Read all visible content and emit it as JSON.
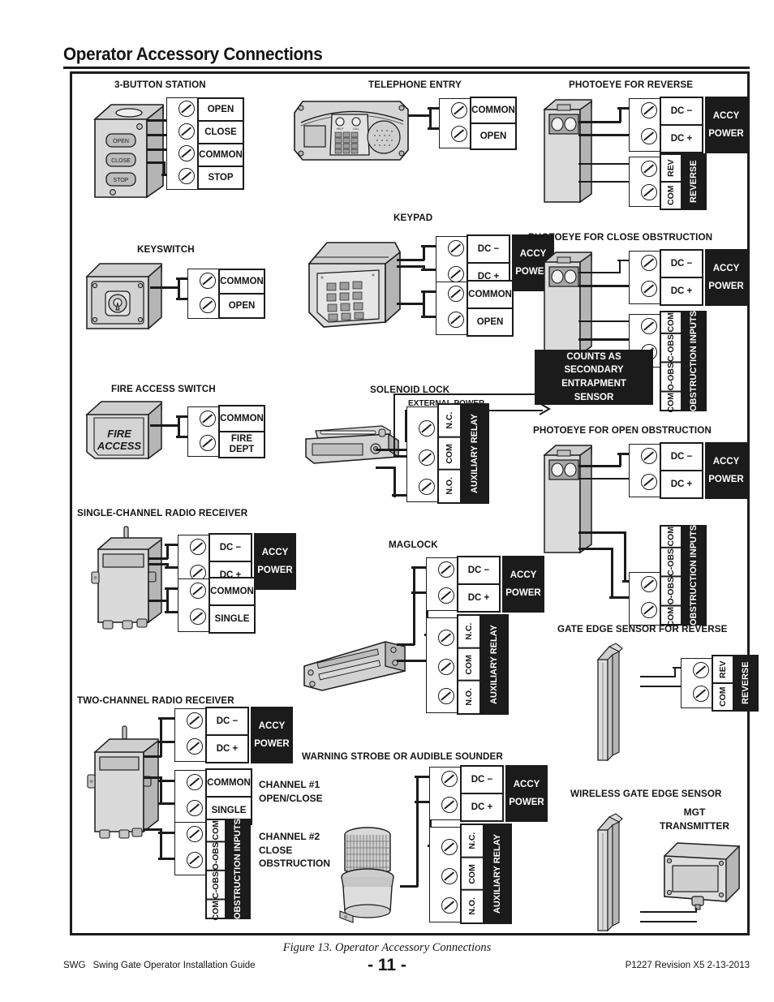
{
  "document": {
    "title": "Operator Accessory Connections",
    "figure_caption": "Figure 13. Operator Accessory Connections",
    "footer_left_code": "SWG",
    "footer_left_text": "Swing Gate Operator Installation Guide",
    "footer_page": "- 11 -",
    "footer_right": "P1227 Revision X5 2-13-2013"
  },
  "labels": {
    "open": "OPEN",
    "close": "CLOSE",
    "common": "COMMON",
    "stop": "STOP",
    "fire_dept": "FIRE DEPT",
    "single": "SINGLE",
    "dc_minus": "DC −",
    "dc_plus": "DC +",
    "accy": "ACCY",
    "power": "POWER",
    "com": "COM",
    "rev": "REV",
    "reverse": "REVERSE",
    "o_obs": "O-OBS",
    "c_obs": "C-OBS",
    "obstruction_inputs": "OBSTRUCTION INPUTS",
    "no": "N.O.",
    "nc": "N.C.",
    "auxiliary_relay": "AUXILIARY RELAY",
    "external_power": "EXTERNAL POWER",
    "fire_access_device": "FIRE ACCESS",
    "btn_open": "OPEN",
    "btn_close": "CLOSE",
    "btn_stop": "STOP"
  },
  "sections": {
    "three_button_station": {
      "title": "3-BUTTON STATION",
      "terminals": [
        "OPEN",
        "CLOSE",
        "COMMON",
        "STOP"
      ]
    },
    "keyswitch": {
      "title": "KEYSWITCH",
      "terminals": [
        "COMMON",
        "OPEN"
      ]
    },
    "fire_access_switch": {
      "title": "FIRE ACCESS SWITCH",
      "terminals": [
        "COMMON",
        "FIRE DEPT"
      ]
    },
    "single_channel_radio": {
      "title": "SINGLE-CHANNEL RADIO RECEIVER",
      "power_terminals": [
        "DC −",
        "DC +"
      ],
      "power_block": [
        "ACCY",
        "POWER"
      ],
      "signal_terminals": [
        "COMMON",
        "SINGLE"
      ]
    },
    "two_channel_radio": {
      "title": "TWO-CHANNEL RADIO RECEIVER",
      "power_terminals": [
        "DC −",
        "DC +"
      ],
      "power_block": [
        "ACCY",
        "POWER"
      ],
      "channel1_terminals": [
        "COMMON",
        "SINGLE"
      ],
      "channel1_note": [
        "CHANNEL #1",
        "OPEN/CLOSE"
      ],
      "channel2_cells": [
        "COM",
        "O-OBS",
        "C-OBS",
        "COM"
      ],
      "channel2_bar": "OBSTRUCTION INPUTS",
      "channel2_note": [
        "CHANNEL #2",
        "CLOSE",
        "OBSTRUCTION"
      ]
    },
    "telephone_entry": {
      "title": "TELEPHONE ENTRY",
      "terminals": [
        "COMMON",
        "OPEN"
      ]
    },
    "keypad": {
      "title": "KEYPAD",
      "power_terminals": [
        "DC −",
        "DC +"
      ],
      "power_block": [
        "ACCY",
        "POWER"
      ],
      "signal_terminals": [
        "COMMON",
        "OPEN"
      ]
    },
    "solenoid_lock": {
      "title": "SOLENOID LOCK",
      "external_power": "EXTERNAL POWER",
      "relay_cells": [
        "N.C.",
        "COM",
        "N.O."
      ],
      "relay_bar": "AUXILIARY RELAY"
    },
    "maglock": {
      "title": "MAGLOCK",
      "power_terminals": [
        "DC −",
        "DC +"
      ],
      "power_block": [
        "ACCY",
        "POWER"
      ],
      "relay_cells": [
        "N.C.",
        "COM",
        "N.O."
      ],
      "relay_bar": "AUXILIARY RELAY"
    },
    "warning_strobe": {
      "title": "WARNING STROBE OR AUDIBLE SOUNDER",
      "power_terminals": [
        "DC −",
        "DC +"
      ],
      "power_block": [
        "ACCY",
        "POWER"
      ],
      "relay_cells": [
        "N.C.",
        "COM",
        "N.O."
      ],
      "relay_bar": "AUXILIARY RELAY"
    },
    "photoeye_reverse": {
      "title": "PHOTOEYE FOR REVERSE",
      "power_terminals": [
        "DC −",
        "DC +"
      ],
      "power_block": [
        "ACCY",
        "POWER"
      ],
      "reverse_cells": [
        "REV",
        "COM"
      ],
      "reverse_bar": "REVERSE"
    },
    "photoeye_close_obstruction": {
      "title": "PHOTOEYE FOR CLOSE OBSTRUCTION",
      "power_terminals": [
        "DC −",
        "DC +"
      ],
      "power_block": [
        "ACCY",
        "POWER"
      ],
      "obstruction_cells": [
        "COM",
        "C-OBS",
        "O-OBS",
        "COM"
      ],
      "obstruction_bar": "OBSTRUCTION INPUTS",
      "note_block": [
        "COUNTS AS",
        "SECONDARY",
        "ENTRAPMENT",
        "SENSOR"
      ]
    },
    "photoeye_open_obstruction": {
      "title": "PHOTOEYE FOR OPEN OBSTRUCTION",
      "power_terminals": [
        "DC −",
        "DC +"
      ],
      "power_block": [
        "ACCY",
        "POWER"
      ],
      "obstruction_cells": [
        "COM",
        "C-OBS",
        "O-OBS",
        "COM"
      ],
      "obstruction_bar": "OBSTRUCTION INPUTS"
    },
    "gate_edge_reverse": {
      "title": "GATE EDGE SENSOR FOR REVERSE",
      "reverse_cells": [
        "REV",
        "COM"
      ],
      "reverse_bar": "REVERSE"
    },
    "wireless_gate_edge": {
      "title": "WIRELESS GATE EDGE SENSOR",
      "transmitter_label": [
        "MGT",
        "TRANSMITTER"
      ]
    }
  },
  "colors": {
    "ink": "#1b1b1b",
    "device_light": "#dcdcdc",
    "device_mid": "#bdbdbd",
    "device_dark": "#9a9a9a",
    "paper": "#ffffff"
  }
}
